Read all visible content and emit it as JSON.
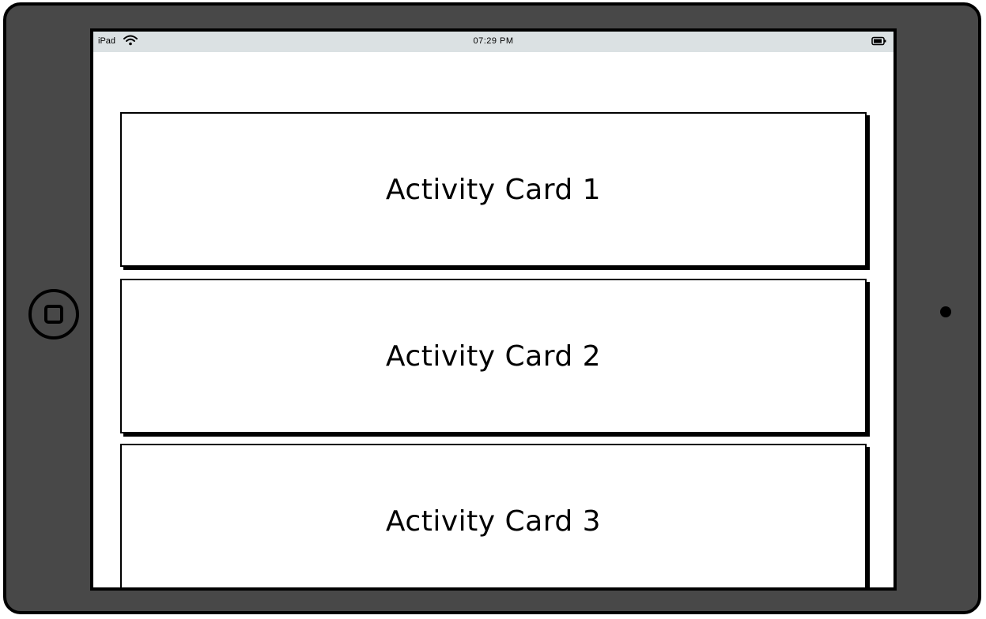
{
  "status_bar": {
    "carrier": "iPad",
    "time": "07:29 PM",
    "wifi_icon": "wifi-icon",
    "battery_icon": "battery-icon"
  },
  "cards": [
    {
      "label": "Activity Card 1"
    },
    {
      "label": "Activity Card 2"
    },
    {
      "label": "Activity Card 3"
    }
  ],
  "device": {
    "home_button_icon": "home-button-icon",
    "camera_icon": "camera-icon",
    "bezel_color": "#484848",
    "status_bar_color": "#dbe1e3"
  }
}
